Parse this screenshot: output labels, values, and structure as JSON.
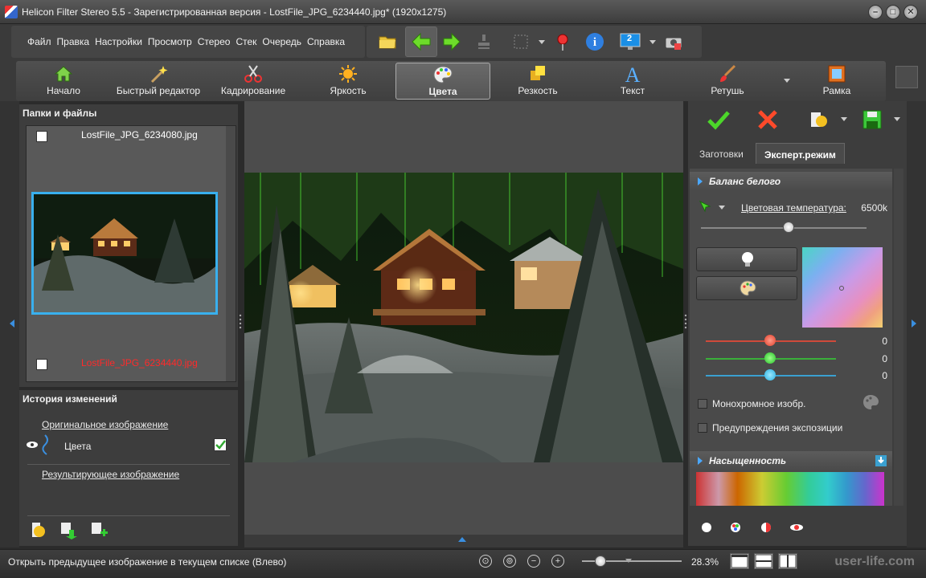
{
  "window": {
    "title": "Helicon Filter Stereo 5.5 - Зарегистрированная версия - LostFile_JPG_6234440.jpg* (1920x1275)",
    "controls": [
      "–",
      "□",
      "✕"
    ]
  },
  "menu": [
    "Файл",
    "Правка",
    "Настройки",
    "Просмотр",
    "Стерео",
    "Стек",
    "Очередь",
    "Справка"
  ],
  "toolbar": {
    "icons": [
      "open-folder-icon",
      "back-arrow-icon",
      "forward-arrow-icon",
      "stamp-icon",
      "selection-icon",
      "pin-icon",
      "info-icon",
      "stereo-monitor-icon",
      "camera-icon"
    ],
    "stereo_badge": "2"
  },
  "tabs": [
    {
      "label": "Начало",
      "icon": "home-icon"
    },
    {
      "label": "Быстрый редактор",
      "icon": "magic-wand-icon"
    },
    {
      "label": "Кадрирование",
      "icon": "scissors-icon"
    },
    {
      "label": "Яркость",
      "icon": "sun-icon"
    },
    {
      "label": "Цвета",
      "icon": "palette-icon",
      "active": true
    },
    {
      "label": "Резкость",
      "icon": "sharpness-icon"
    },
    {
      "label": "Текст",
      "icon": "text-icon"
    },
    {
      "label": "Ретушь",
      "icon": "brush-icon"
    },
    {
      "label": "Рамка",
      "icon": "frame-icon"
    }
  ],
  "files_panel": {
    "title": "Папки и файлы",
    "files": [
      {
        "name": "LostFile_JPG_6234080.jpg",
        "current": false
      },
      {
        "name": "LostFile_JPG_6234440.jpg",
        "current": true
      }
    ]
  },
  "history_panel": {
    "title": "История изменений",
    "original": "Оригинальное изображение",
    "step": "Цвета",
    "result": "Результирующее изображение"
  },
  "right_panel": {
    "tabs": [
      "Заготовки",
      "Эксперт.режим"
    ],
    "active_tab": "Эксперт.режим",
    "white_balance": {
      "title": "Баланс белого",
      "temp_label": "Цветовая температура:",
      "temp_value": "6500k",
      "r": "0",
      "g": "0",
      "b": "0"
    },
    "monochrome_label": "Монохромное изобр.",
    "exposure_warn_label": "Предупреждения экспозиции",
    "saturation_title": "Насыщенность"
  },
  "status": {
    "text": "Открыть предыдущее изображение в текущем списке (Влево)",
    "zoom": "28.3%",
    "watermark": "user-life.com"
  },
  "colors": {
    "accent": "#39b0ee",
    "current_file": "#ff2a2a",
    "panel_bg": "#3d3d3d"
  }
}
